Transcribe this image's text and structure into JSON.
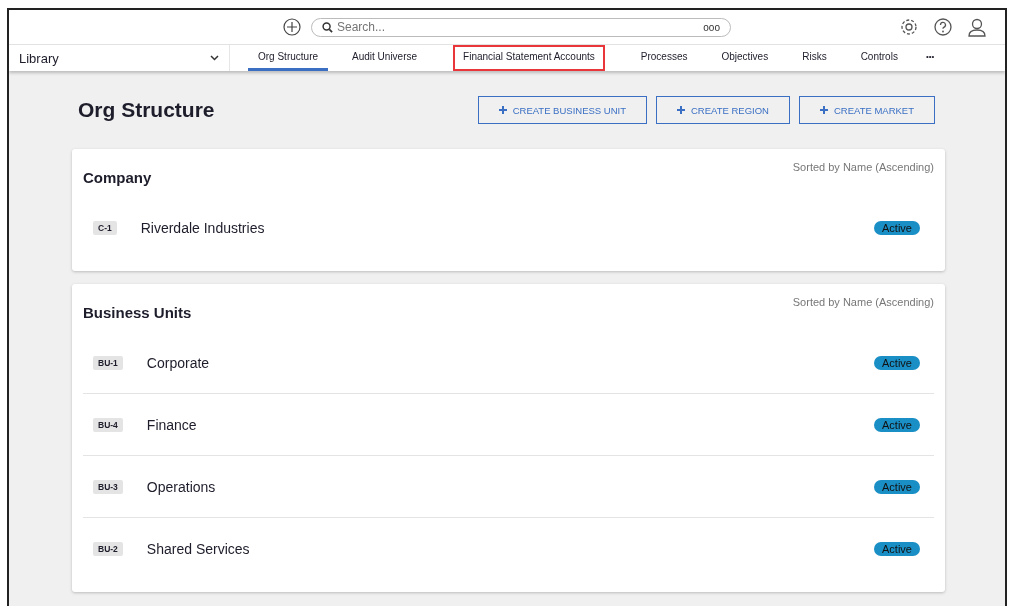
{
  "top_bar": {
    "search": {
      "placeholder": "Search..."
    },
    "search_options": "ooo"
  },
  "nav": {
    "library": "Library",
    "tabs": [
      {
        "label": "Org Structure",
        "selected": true,
        "highlighted": false
      },
      {
        "label": "Audit Universe",
        "selected": false,
        "highlighted": false
      },
      {
        "label": "Financial Statement Accounts",
        "selected": false,
        "highlighted": true
      },
      {
        "label": "Processes",
        "selected": false,
        "highlighted": false
      },
      {
        "label": "Objectives",
        "selected": false,
        "highlighted": false
      },
      {
        "label": "Risks",
        "selected": false,
        "highlighted": false
      },
      {
        "label": "Controls",
        "selected": false,
        "highlighted": false
      }
    ],
    "more": "•••"
  },
  "page": {
    "title": "Org Structure",
    "buttons": [
      "CREATE BUSINESS UNIT",
      "CREATE REGION",
      "CREATE MARKET"
    ]
  },
  "sections": [
    {
      "title": "Company",
      "sort": "Sorted by Name (Ascending)",
      "rows": [
        {
          "code": "C-1",
          "name": "Riverdale Industries",
          "status": "Active"
        }
      ]
    },
    {
      "title": "Business Units",
      "sort": "Sorted by Name (Ascending)",
      "rows": [
        {
          "code": "BU-1",
          "name": "Corporate",
          "status": "Active"
        },
        {
          "code": "BU-4",
          "name": "Finance",
          "status": "Active"
        },
        {
          "code": "BU-3",
          "name": "Operations",
          "status": "Active"
        },
        {
          "code": "BU-2",
          "name": "Shared Services",
          "status": "Active"
        }
      ]
    }
  ]
}
